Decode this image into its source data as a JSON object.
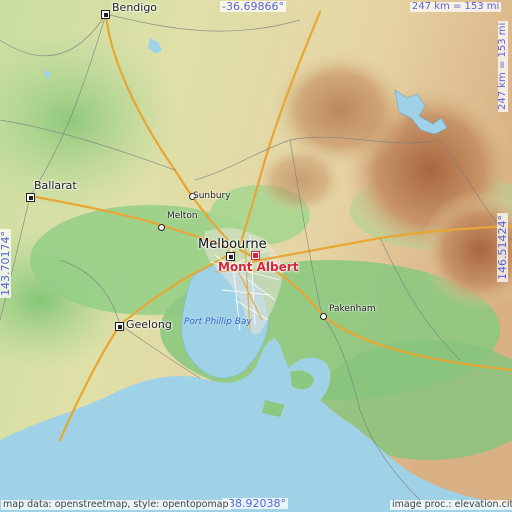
{
  "map": {
    "target": "Mont Albert",
    "places": {
      "bendigo": "Bendigo",
      "ballarat": "Ballarat",
      "sunbury": "Sunbury",
      "melton": "Melton",
      "melbourne": "Melbourne",
      "pakenham": "Pakenham",
      "geelong": "Geelong"
    },
    "water": {
      "port_phillip": "Port Phillip Bay"
    },
    "coords": {
      "top": "-36.69866°",
      "bottom": "-38.92038°",
      "left": "143.70174°",
      "right": "146.51424°"
    },
    "scale": {
      "top": "247 km = 153 mi",
      "right": "247 km = 153 mi"
    },
    "attribution": {
      "left": "map data: openstreetmap, style: opentopomap",
      "right": "image proc.: elevation.city"
    },
    "colors": {
      "sea": "#9fd2e6",
      "lowland": "#8fd08a",
      "hills": "#e8d8a8",
      "mountains": "#c4875a",
      "accent": "#d7253a",
      "coord_text": "#5a64d2"
    }
  }
}
